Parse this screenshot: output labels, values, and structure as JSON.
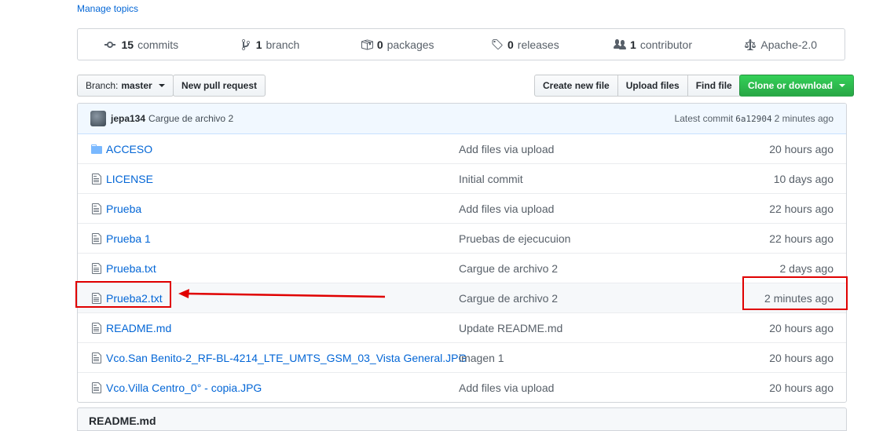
{
  "manage_topics": "Manage topics",
  "summary": {
    "commits": {
      "count": "15",
      "label": "commits"
    },
    "branches": {
      "count": "1",
      "label": "branch"
    },
    "packages": {
      "count": "0",
      "label": "packages"
    },
    "releases": {
      "count": "0",
      "label": "releases"
    },
    "contributors": {
      "count": "1",
      "label": "contributor"
    },
    "license": "Apache-2.0"
  },
  "toolbar": {
    "branch_prefix": "Branch:",
    "branch_name": "master",
    "new_pr": "New pull request",
    "create_file": "Create new file",
    "upload_files": "Upload files",
    "find_file": "Find file",
    "clone": "Clone or download"
  },
  "latest_commit": {
    "author": "jepa134",
    "message": "Cargue de archivo 2",
    "label": "Latest commit",
    "sha": "6a12904",
    "age": "2 minutes ago"
  },
  "files": [
    {
      "type": "folder",
      "name": "ACCESO",
      "message": "Add files via upload",
      "age": "20 hours ago"
    },
    {
      "type": "file",
      "name": "LICENSE",
      "message": "Initial commit",
      "age": "10 days ago"
    },
    {
      "type": "file",
      "name": "Prueba",
      "message": "Add files via upload",
      "age": "22 hours ago"
    },
    {
      "type": "file",
      "name": "Prueba 1",
      "message": "Pruebas de ejecucuion",
      "age": "22 hours ago"
    },
    {
      "type": "file",
      "name": "Prueba.txt",
      "message": "Cargue de archivo 2",
      "age": "2 days ago"
    },
    {
      "type": "file",
      "name": "Prueba2.txt",
      "message": "Cargue de archivo 2",
      "age": "2 minutes ago"
    },
    {
      "type": "file",
      "name": "README.md",
      "message": "Update README.md",
      "age": "20 hours ago"
    },
    {
      "type": "file",
      "name": "Vco.San Benito-2_RF-BL-4214_LTE_UMTS_GSM_03_Vista General.JPG",
      "message": "imagen 1",
      "age": "20 hours ago"
    },
    {
      "type": "file",
      "name": "Vco.Villa Centro_0° - copia.JPG",
      "message": "Add files via upload",
      "age": "20 hours ago"
    }
  ],
  "readme_header": "README.md",
  "annotation_color": "#e00000"
}
